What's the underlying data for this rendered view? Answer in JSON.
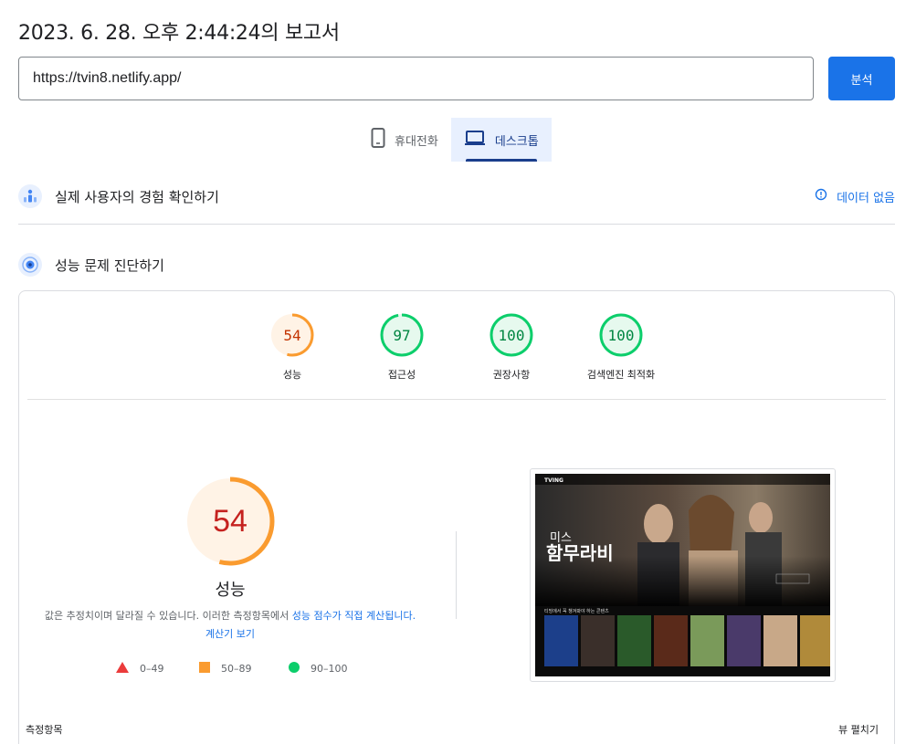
{
  "header": {
    "title": "2023. 6. 28. 오후 2:44:24의 보고서",
    "url_value": "https://tvin8.netlify.app/",
    "analyze_label": "분석"
  },
  "tabs": [
    {
      "label": "휴대전화",
      "icon": "phone-icon",
      "active": false
    },
    {
      "label": "데스크톱",
      "icon": "laptop-icon",
      "active": true
    }
  ],
  "sections": {
    "real_user": {
      "title": "실제 사용자의 경험 확인하기",
      "no_data_label": "데이터 없음"
    },
    "diagnose": {
      "title": "성능 문제 진단하기"
    }
  },
  "scores": [
    {
      "label": "성능",
      "value": "54",
      "fraction": 0.54,
      "color": "#fa9b2f"
    },
    {
      "label": "접근성",
      "value": "97",
      "fraction": 0.97,
      "color": "#0cce6b"
    },
    {
      "label": "권장사항",
      "value": "100",
      "fraction": 1.0,
      "color": "#0cce6b"
    },
    {
      "label": "검색엔진 최적화",
      "value": "100",
      "fraction": 1.0,
      "color": "#0cce6b"
    }
  ],
  "main_score": {
    "value": "54",
    "fraction": 0.54,
    "label": "성능",
    "desc_prefix": "값은 추정치이며 달라질 수 있습니다. 이러한 측정항목에서 ",
    "desc_link1": "성능 점수가 직접 계산됩니다",
    "desc_mid": ". ",
    "desc_link2": "계산기 보기"
  },
  "legend": [
    {
      "range": "0–49",
      "color": "#eb3b3b",
      "shape": "triangle"
    },
    {
      "range": "50–89",
      "color": "#fa9b2f",
      "shape": "square"
    },
    {
      "range": "90–100",
      "color": "#0cce6b",
      "shape": "circle"
    }
  ],
  "screenshot": {
    "brand": "TVING",
    "hero_title_small": "미스",
    "hero_title": "함무라비",
    "row_title": "티빙에서 꼭 챙겨봐야 하는 콘텐츠"
  },
  "footer": {
    "metrics_label": "측정항목",
    "expand_label": "뷰 펼치기"
  },
  "colors": {
    "accent": "#1a73e8",
    "tab_active_bg": "#e8f0fe",
    "average": "#fa9b2f",
    "pass": "#0cce6b",
    "fail": "#eb3b3b"
  }
}
